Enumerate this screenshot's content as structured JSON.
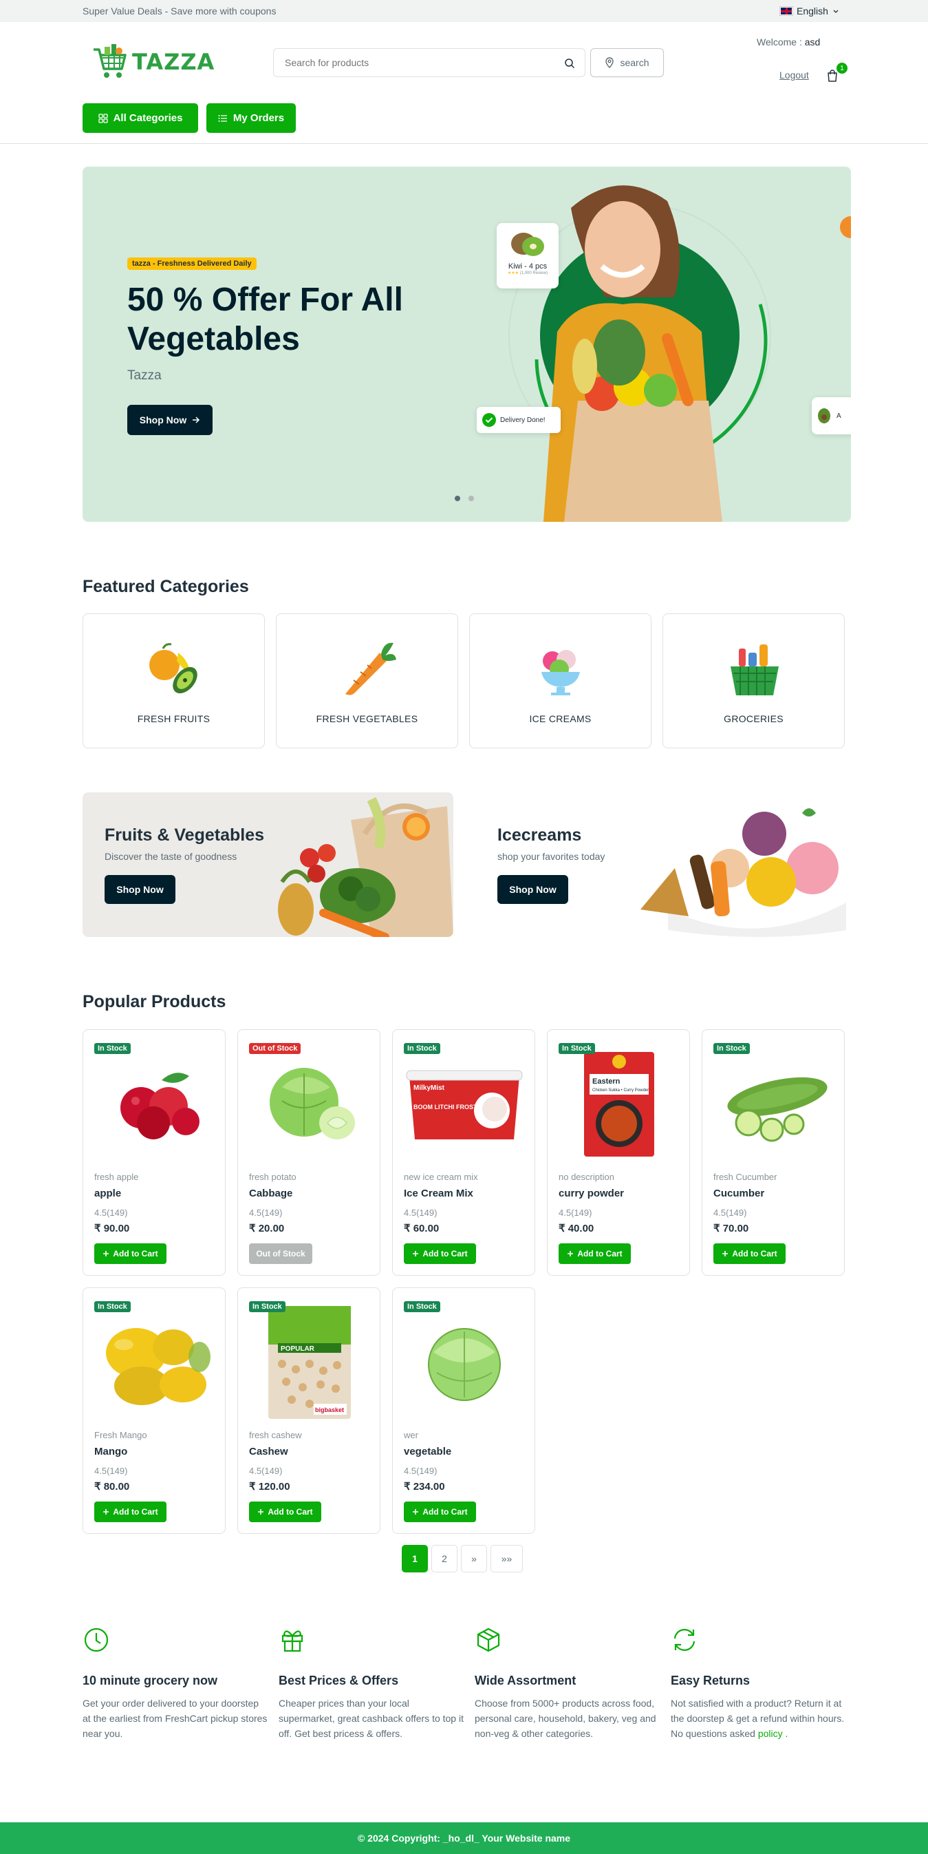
{
  "topbar": {
    "promo": "Super Value Deals - Save more with coupons",
    "language": "English"
  },
  "header": {
    "logo_text": "TAZZA",
    "search_placeholder": "Search for products",
    "location_button": "search",
    "welcome_prefix": "Welcome : ",
    "username": "asd",
    "logout": "Logout",
    "cart_count": "1"
  },
  "nav": {
    "all_categories": "All Categories",
    "my_orders": "My Orders"
  },
  "hero": {
    "tag": "tazza - Freshness Delivered Daily",
    "title": "50 % Offer For All Vegetables",
    "subtitle": "Tazza",
    "button": "Shop Now",
    "kiwi_label": "Kiwi - 4 pcs",
    "kiwi_reviews": "(1,000 Review)",
    "delivery": "Delivery Done!",
    "side_card": "A"
  },
  "featured": {
    "title": "Featured Categories",
    "items": [
      "FRESH FRUITS",
      "FRESH VEGETABLES",
      "ICE CREAMS",
      "GROCERIES"
    ]
  },
  "banners": [
    {
      "title": "Fruits & Vegetables",
      "subtitle": "Discover the taste of goodness",
      "button": "Shop Now"
    },
    {
      "title": "Icecreams",
      "subtitle": "shop your favorites today",
      "button": "Shop Now"
    }
  ],
  "popular": {
    "title": "Popular Products",
    "products": [
      {
        "status": "In Stock",
        "desc": "fresh apple",
        "name": "apple",
        "rating": "4.5(149)",
        "price": "₹ 90.00",
        "button": "Add to Cart"
      },
      {
        "status": "Out of Stock",
        "desc": "fresh potato",
        "name": "Cabbage",
        "rating": "4.5(149)",
        "price": "₹ 20.00",
        "button": "Out of Stock"
      },
      {
        "status": "In Stock",
        "desc": "new ice cream mix",
        "name": "Ice Cream Mix",
        "rating": "4.5(149)",
        "price": "₹ 60.00",
        "button": "Add to Cart"
      },
      {
        "status": "In Stock",
        "desc": "no description",
        "name": "curry powder",
        "rating": "4.5(149)",
        "price": "₹ 40.00",
        "button": "Add to Cart"
      },
      {
        "status": "In Stock",
        "desc": "fresh Cucumber",
        "name": "Cucumber",
        "rating": "4.5(149)",
        "price": "₹ 70.00",
        "button": "Add to Cart"
      },
      {
        "status": "In Stock",
        "desc": "Fresh Mango",
        "name": "Mango",
        "rating": "4.5(149)",
        "price": "₹ 80.00",
        "button": "Add to Cart"
      },
      {
        "status": "In Stock",
        "desc": "fresh cashew",
        "name": "Cashew",
        "rating": "4.5(149)",
        "price": "₹ 120.00",
        "button": "Add to Cart"
      },
      {
        "status": "In Stock",
        "desc": "wer",
        "name": "vegetable",
        "rating": "4.5(149)",
        "price": "₹ 234.00",
        "button": "Add to Cart"
      }
    ],
    "package_labels": {
      "icecream_brand": "MilkyMist",
      "icecream_flavour": "BOOM LITCHI FROSTY",
      "curry_brand": "Eastern",
      "curry_name": "Chicken Sukka • Curry Powder",
      "cashew_brand": "POPULAR",
      "cashew_store": "bigbasket"
    }
  },
  "pagination": {
    "pages": [
      "1",
      "2"
    ],
    "next": "»",
    "last": "»»"
  },
  "features": [
    {
      "icon": "clock-icon",
      "title": "10 minute grocery now",
      "text": "Get your order delivered to your doorstep at the earliest from FreshCart pickup stores near you."
    },
    {
      "icon": "gift-icon",
      "title": "Best Prices & Offers",
      "text": "Cheaper prices than your local supermarket, great cashback offers to top it off. Get best pricess & offers."
    },
    {
      "icon": "package-icon",
      "title": "Wide Assortment",
      "text": "Choose from 5000+ products across food, personal care, household, bakery, veg and non-veg & other categories."
    },
    {
      "icon": "refresh-icon",
      "title": "Easy Returns",
      "text": "Not satisfied with a product? Return it at the doorstep & get a refund within hours. No questions asked",
      "link": "policy",
      "after": " ."
    }
  ],
  "footer": {
    "copyright": "© 2024 Copyright: _ho_dl_ Your Website name"
  },
  "colors": {
    "brand_green": "#0aad0a",
    "dark": "#001e2b",
    "out_of_stock": "#db3030",
    "in_stock": "#198754",
    "footer": "#1fae56"
  }
}
